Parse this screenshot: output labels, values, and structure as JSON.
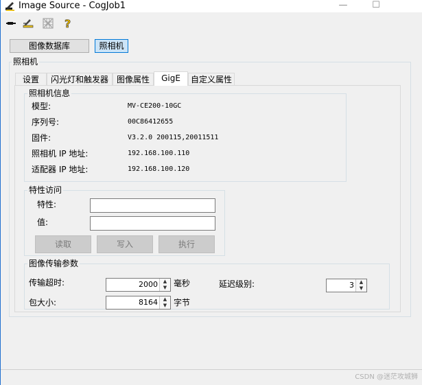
{
  "window": {
    "title": "Image Source - CogJob1",
    "minimize": "—",
    "maximize": "☐"
  },
  "toolbar": {
    "icons": [
      "plug-icon",
      "edit-icon",
      "grid-icon",
      "help-icon"
    ]
  },
  "mode_buttons": {
    "database": "图像数据库",
    "camera": "照相机"
  },
  "camera_group_title": "照相机",
  "tabs": [
    "设置",
    "闪光灯和触发器",
    "图像属性",
    "GigE",
    "自定义属性"
  ],
  "camera_info": {
    "title": "照相机信息",
    "rows": [
      {
        "label": "模型:",
        "value": "MV-CE200-10GC"
      },
      {
        "label": "序列号:",
        "value": "00C86412655"
      },
      {
        "label": "固件:",
        "value": "V3.2.0 200115,20011511"
      },
      {
        "label": "照相机 IP 地址:",
        "value": "192.168.100.110"
      },
      {
        "label": "适配器 IP 地址:",
        "value": "192.168.100.120"
      }
    ]
  },
  "feature_access": {
    "title": "特性访问",
    "feature_label": "特性:",
    "value_label": "值:",
    "read": "读取",
    "write": "写入",
    "execute": "执行"
  },
  "transfer": {
    "title": "图像传输参数",
    "timeout_label": "传输超时:",
    "timeout_value": "2000",
    "timeout_unit": "毫秒",
    "latency_label": "延迟级别:",
    "latency_value": "3",
    "packet_label": "包大小:",
    "packet_value": "8164",
    "packet_unit": "字节"
  },
  "watermark": "CSDN @迷茫攻城狮"
}
